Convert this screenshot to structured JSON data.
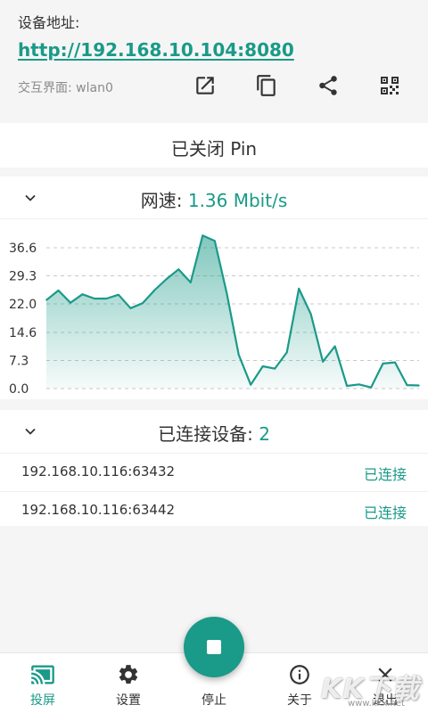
{
  "header": {
    "address_label": "设备地址:",
    "address_url": "http://192.168.10.104:8080",
    "interface_label": "交互界面: wlan0",
    "actions": [
      {
        "icon": "open-external-icon"
      },
      {
        "icon": "copy-icon"
      },
      {
        "icon": "share-icon"
      },
      {
        "icon": "qr-code-icon"
      }
    ]
  },
  "pin": {
    "status_label": "已关闭 Pin"
  },
  "speed": {
    "title_prefix": "网速: ",
    "value": "1.36 Mbit/s"
  },
  "chart_data": {
    "type": "area",
    "ylim": [
      0.0,
      36.6
    ],
    "yticks": [
      "0.0",
      "7.3",
      "14.6",
      "22.0",
      "29.3",
      "36.6"
    ],
    "grid": true,
    "color": "#1a9a88",
    "values": [
      23.0,
      25.5,
      22.3,
      24.5,
      23.4,
      23.4,
      24.4,
      20.9,
      22.2,
      25.6,
      28.5,
      31.0,
      27.6,
      39.8,
      38.4,
      24.8,
      8.8,
      1.0,
      5.8,
      5.2,
      9.4,
      26.0,
      19.4,
      7.0,
      11.0,
      0.7,
      1.1,
      0.3,
      6.5,
      6.8,
      0.9,
      0.8
    ]
  },
  "clients": {
    "title_prefix": "已连接设备: ",
    "count": "2",
    "items": [
      {
        "address": "192.168.10.116:63432",
        "status": "已连接"
      },
      {
        "address": "192.168.10.116:63442",
        "status": "已连接"
      }
    ]
  },
  "nav": [
    {
      "label": "投屏",
      "icon": "cast-icon",
      "active": true
    },
    {
      "label": "设置",
      "icon": "gear-icon",
      "active": false
    },
    {
      "label": "停止",
      "icon": "stop-icon",
      "active": false
    },
    {
      "label": "关于",
      "icon": "info-icon",
      "active": false
    },
    {
      "label": "退出",
      "icon": "close-icon",
      "active": false
    }
  ],
  "watermark": {
    "main": "KK下载",
    "sub": "www.kkx.net"
  },
  "colors": {
    "accent": "#1a9a88",
    "background": "#f5f5f5",
    "card": "#ffffff"
  }
}
